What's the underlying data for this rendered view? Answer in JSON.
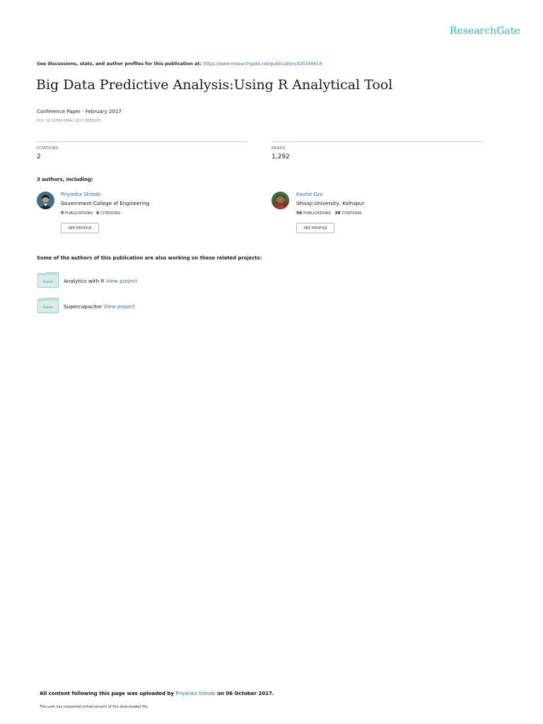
{
  "brand": "ResearchGate",
  "discuss": {
    "prefix": "See discussions, stats, and author profiles for this publication at:",
    "url": "https://www.researchgate.net/publication/320345614"
  },
  "paper": {
    "title": "Big Data Predictive Analysis:Using R Analytical Tool",
    "type_date": "Conference Paper · February 2017",
    "doi": "DOI: 10.1109/I-SMAC.2017.8058297"
  },
  "stats": {
    "citations_label": "CITATIONS",
    "citations_value": "2",
    "reads_label": "READS",
    "reads_value": "1,292"
  },
  "authors_heading": "3 authors, including:",
  "authors": [
    {
      "name": "Priyanka Shinde",
      "institution": "Government College of Engineering",
      "publications_count": "9",
      "publications_label": "PUBLICATIONS",
      "citations_count": "6",
      "citations_label": "CITATIONS",
      "button": "SEE PROFILE"
    },
    {
      "name": "Kavita Oza",
      "institution": "Shivaji University, Kolhapur",
      "publications_count": "56",
      "publications_label": "PUBLICATIONS",
      "citations_count": "38",
      "citations_label": "CITATIONS",
      "button": "SEE PROFILE"
    }
  ],
  "related_heading": "Some of the authors of this publication are also working on these related projects:",
  "projects": [
    {
      "folder_label": "Project",
      "name": "Analytics with R",
      "link": "View project"
    },
    {
      "folder_label": "Project",
      "name": "Supercapacitor",
      "link": "View project"
    }
  ],
  "footer": {
    "prefix": "All content following this page was uploaded by",
    "uploader": "Priyanka Shinde",
    "suffix": "on 06 October 2017.",
    "note": "The user has requested enhancement of the downloaded file."
  },
  "colors": {
    "brand": "#20c5b0",
    "link": "#2d6fb0",
    "folder": "#cbe8e4"
  }
}
